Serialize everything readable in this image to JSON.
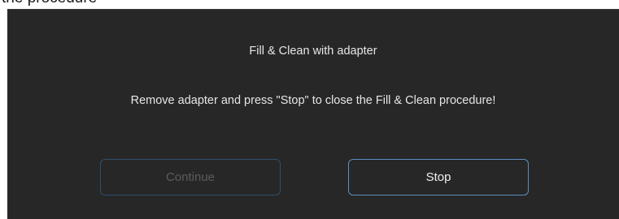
{
  "header": {
    "partial_text": "the procedure"
  },
  "dialog": {
    "title": "Fill & Clean with adapter",
    "message": "Remove adapter and press \"Stop\" to close the Fill & Clean procedure!",
    "buttons": {
      "continue_label": "Continue",
      "continue_state": "disabled",
      "stop_label": "Stop"
    }
  },
  "colors": {
    "dialog_background": "#272727",
    "text": "#e6e6e6",
    "stop_border": "#5a8fc2",
    "continue_border": "#2f4f6c",
    "disabled_text": "#5c5c5c"
  }
}
